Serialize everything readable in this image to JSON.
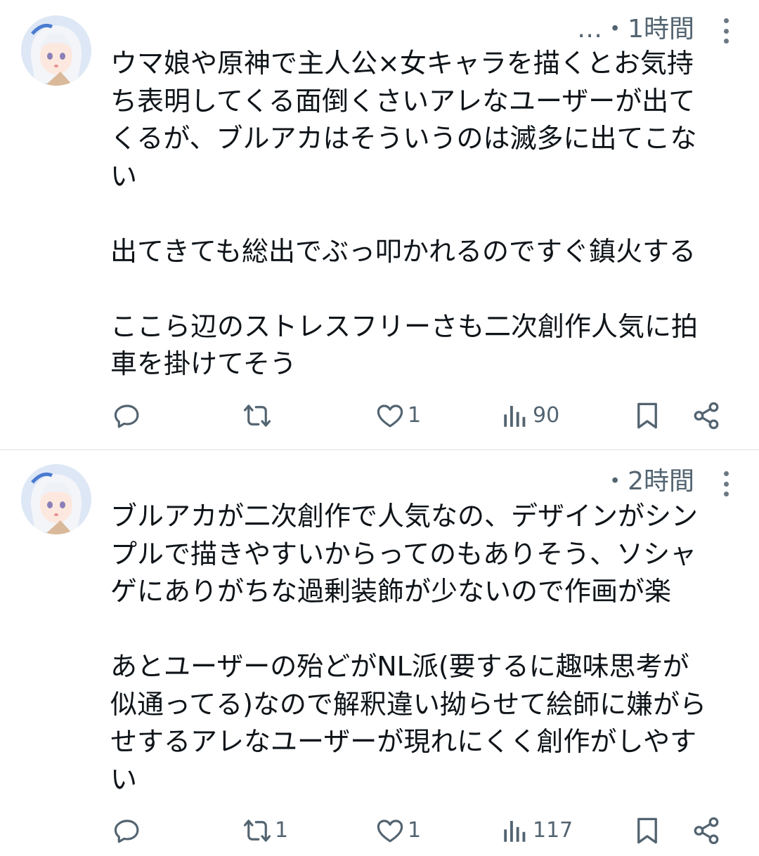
{
  "posts": [
    {
      "id": "post-1",
      "meta": "…・1時間",
      "text": "ウマ娘や原神で主人公×女キャラを描くとお気持\nち表明してくる面倒くさいアレなユーザーが出て\nくるが、ブルアカはそういうのは滅多に出てこな\nい\n\n出てきても総出でぶっ叩かれるのですぐ鎮火する\n\nここら辺のストレスフリーさも二次創作人気に拍\n車を掛けてそう",
      "counts": {
        "reply": "",
        "repost": "",
        "like": "1",
        "views": "90"
      }
    },
    {
      "id": "post-2",
      "meta": "・2時間",
      "text": "ブルアカが二次創作で人気なの、デザインがシン\nプルで描きやすいからってのもありそう、ソシャ\nゲにありがちな過剰装飾が少ないので作画が楽\n\nあとユーザーの殆どがNL派(要するに趣味思考が\n似通ってる)なので解釈違い拗らせて絵師に嫌がら\nせするアレなユーザーが現れにくく創作がしやす\nい",
      "counts": {
        "reply": "",
        "repost": "1",
        "like": "1",
        "views": "117"
      }
    }
  ],
  "icons": {
    "reply": "reply-icon",
    "repost": "repost-icon",
    "like": "heart-icon",
    "views": "views-icon",
    "bookmark": "bookmark-icon",
    "share": "share-icon",
    "more": "more-icon"
  },
  "colors": {
    "text": "#0f1419",
    "secondary": "#536471",
    "divider": "#e1e4e7"
  }
}
